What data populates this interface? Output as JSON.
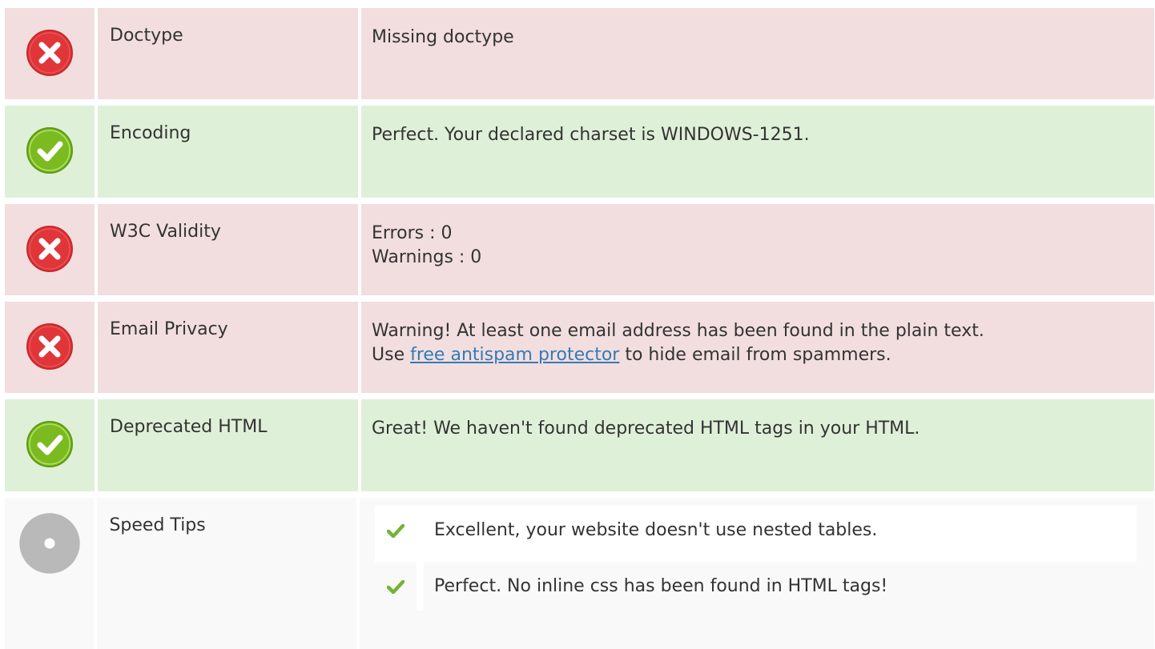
{
  "rows": [
    {
      "status": "error",
      "icon": "error-icon",
      "name": "Doctype",
      "value": "Missing doctype"
    },
    {
      "status": "ok",
      "icon": "success-icon",
      "name": "Encoding",
      "value": "Perfect. Your declared charset is WINDOWS-1251."
    },
    {
      "status": "error",
      "icon": "error-icon",
      "name": "W3C Validity",
      "value_line1": "Errors : 0",
      "value_line2": "Warnings : 0"
    },
    {
      "status": "error",
      "icon": "error-icon",
      "name": "Email Privacy",
      "value_line1": "Warning! At least one email address has been found in the plain text.",
      "value_pre_link": "Use ",
      "link_text": "free antispam protector",
      "value_post_link": " to hide email from spammers."
    },
    {
      "status": "ok",
      "icon": "success-icon",
      "name": "Deprecated HTML",
      "value": "Great! We haven't found deprecated HTML tags in your HTML."
    },
    {
      "status": "neutral",
      "icon": "neutral-icon",
      "name": "Speed Tips",
      "tips": [
        {
          "icon": "checkmark-icon",
          "text": "Excellent, your website doesn't use nested tables."
        },
        {
          "icon": "checkmark-icon",
          "text": "Perfect. No inline css has been found in HTML tags!"
        }
      ]
    }
  ],
  "colors": {
    "error_bg": "#f2dede",
    "ok_bg": "#dff0d8",
    "neutral_bg": "#f9f9f9",
    "error_icon": "#e0363a",
    "ok_icon": "#7cbb1f",
    "neutral_icon": "#b9b9b9",
    "checkmark": "#76b236",
    "link": "#337ab7"
  }
}
